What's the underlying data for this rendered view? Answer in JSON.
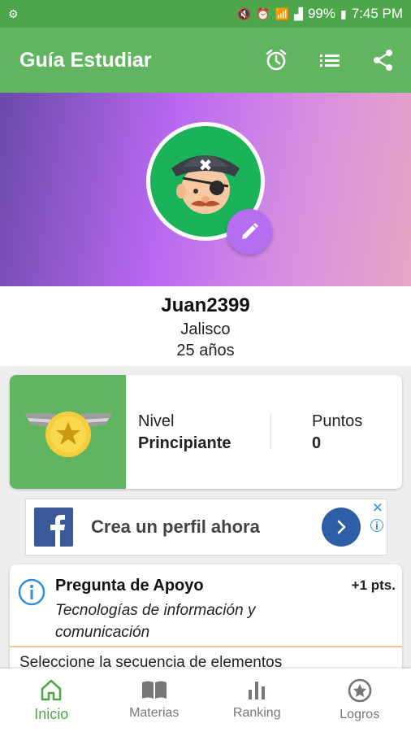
{
  "status_bar": {
    "battery": "99%",
    "time": "7:45 PM",
    "icons": [
      "settings-icon",
      "mute-icon",
      "alarm-icon",
      "wifi-icon",
      "signal-icon",
      "battery-icon"
    ]
  },
  "app_bar": {
    "title": "Guía Estudiar",
    "actions": [
      "alarm-icon",
      "list-icon",
      "share-icon"
    ]
  },
  "profile": {
    "username": "Juan2399",
    "state": "Jalisco",
    "age": "25 años"
  },
  "level_card": {
    "level_label": "Nivel",
    "level_value": "Principiante",
    "points_label": "Puntos",
    "points_value": "0"
  },
  "ad": {
    "text": "Crea un perfil ahora",
    "close_symbol": "✕",
    "info_symbol": "i"
  },
  "question": {
    "title": "Pregunta de Apoyo",
    "points": "+1 pts.",
    "subject": "Tecnologías de información y comunicación",
    "text": "Seleccione la secuencia de elementos"
  },
  "bottom_nav": {
    "items": [
      {
        "label": "Inicio",
        "icon": "home-icon",
        "active": true
      },
      {
        "label": "Materias",
        "icon": "book-icon",
        "active": false
      },
      {
        "label": "Ranking",
        "icon": "bar-chart-icon",
        "active": false
      },
      {
        "label": "Logros",
        "icon": "star-badge-icon",
        "active": false
      }
    ]
  },
  "colors": {
    "status_bar": "#4ea64c",
    "app_bar": "#62b560",
    "accent": "#b56ef0",
    "active_nav": "#4ea64c"
  }
}
